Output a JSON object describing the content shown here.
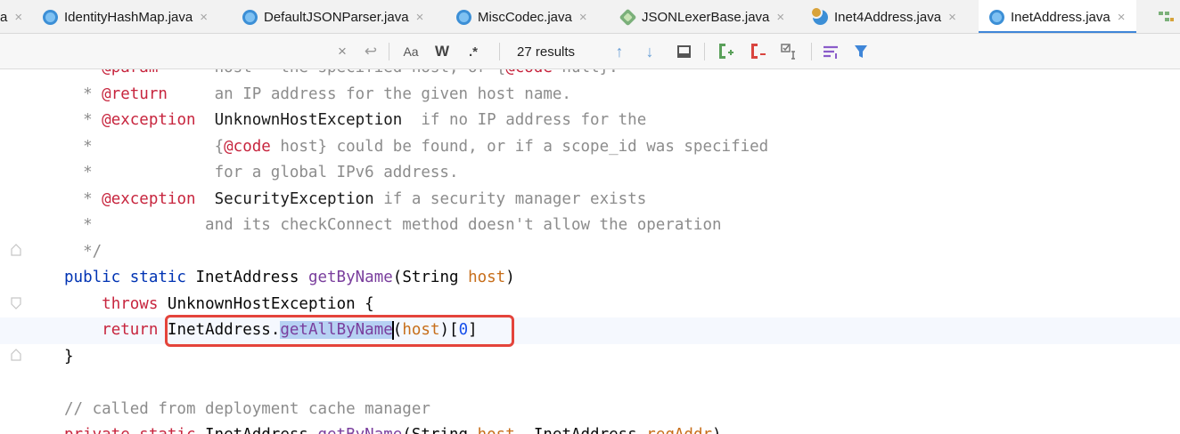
{
  "tabs": [
    {
      "label": "a",
      "icon": "java-class-icon",
      "active": false
    },
    {
      "label": "IdentityHashMap.java",
      "icon": "java-class-icon",
      "active": false
    },
    {
      "label": "DefaultJSONParser.java",
      "icon": "java-class-icon",
      "active": false
    },
    {
      "label": "MiscCodec.java",
      "icon": "java-class-icon",
      "active": false
    },
    {
      "label": "JSONLexerBase.java",
      "icon": "abstract-class-icon",
      "active": false
    },
    {
      "label": "Inet4Address.java",
      "icon": "java-class-icon",
      "active": false
    },
    {
      "label": "InetAddress.java",
      "icon": "java-class-icon",
      "active": true
    }
  ],
  "find_bar": {
    "results": "27 results",
    "case_label": "Aa",
    "word_label": "W",
    "regex_label": ".*"
  },
  "code_lines": [
    {
      "n": 0,
      "segments": [
        [
          "doc",
          "  * "
        ],
        [
          "tag",
          "@param"
        ],
        [
          "doc",
          "      host   the specified host, or {"
        ],
        [
          "tag",
          "@code"
        ],
        [
          "doc",
          " null}."
        ]
      ]
    },
    {
      "n": 1,
      "segments": [
        [
          "doc",
          "  * "
        ],
        [
          "tag",
          "@return"
        ],
        [
          "doc",
          "     an IP address for the given host name."
        ]
      ]
    },
    {
      "n": 2,
      "segments": [
        [
          "doc",
          "  * "
        ],
        [
          "tag",
          "@exception"
        ],
        [
          "doc",
          "  "
        ],
        [
          "docplain",
          "UnknownHostException"
        ],
        [
          "doc",
          "  if no IP address for the"
        ]
      ]
    },
    {
      "n": 3,
      "segments": [
        [
          "doc",
          "  *             {"
        ],
        [
          "tag",
          "@code"
        ],
        [
          "doc",
          " host} could be found, or if a scope_id was specified"
        ]
      ]
    },
    {
      "n": 4,
      "segments": [
        [
          "doc",
          "  *             for a global IPv6 address."
        ]
      ]
    },
    {
      "n": 5,
      "segments": [
        [
          "doc",
          "  * "
        ],
        [
          "tag",
          "@exception"
        ],
        [
          "doc",
          "  "
        ],
        [
          "docplain",
          "SecurityException"
        ],
        [
          "doc",
          " if a security manager exists"
        ]
      ]
    },
    {
      "n": 6,
      "segments": [
        [
          "doc",
          "  *            and its checkConnect method doesn't allow the operation"
        ]
      ]
    },
    {
      "n": 7,
      "segments": [
        [
          "doc",
          "  */"
        ]
      ]
    },
    {
      "n": 8,
      "segments": [
        [
          "kw",
          "public static "
        ],
        [
          "plain",
          "InetAddress "
        ],
        [
          "fn",
          "getByName"
        ],
        [
          "plain",
          "(String "
        ],
        [
          "par",
          "host"
        ],
        [
          "plain",
          ")"
        ]
      ]
    },
    {
      "n": 9,
      "segments": [
        [
          "plain",
          "    "
        ],
        [
          "kw2",
          "throws "
        ],
        [
          "plain",
          "UnknownHostException {"
        ]
      ]
    },
    {
      "n": 10,
      "segments": [
        [
          "plain",
          "    "
        ],
        [
          "kw2",
          "return "
        ],
        [
          "plain",
          "InetAddress."
        ],
        [
          "fnhl",
          "getAllByName"
        ],
        [
          "caret",
          ""
        ],
        [
          "plain",
          "("
        ],
        [
          "par",
          "host"
        ],
        [
          "plain",
          ")["
        ],
        [
          "num",
          "0"
        ],
        [
          "plain",
          "]"
        ]
      ]
    },
    {
      "n": 11,
      "segments": [
        [
          "plain",
          "}"
        ]
      ]
    },
    {
      "n": 12,
      "segments": [
        [
          "plain",
          ""
        ]
      ]
    },
    {
      "n": 13,
      "segments": [
        [
          "com",
          "// called from deployment cache manager"
        ]
      ]
    },
    {
      "n": 14,
      "segments": [
        [
          "kw2",
          "private static "
        ],
        [
          "plain",
          "InetAddress "
        ],
        [
          "fn",
          "getByName"
        ],
        [
          "plain",
          "(String "
        ],
        [
          "par",
          "host"
        ],
        [
          "plain",
          ", InetAddress "
        ],
        [
          "par",
          "reqAddr"
        ],
        [
          "plain",
          ")"
        ]
      ]
    }
  ]
}
